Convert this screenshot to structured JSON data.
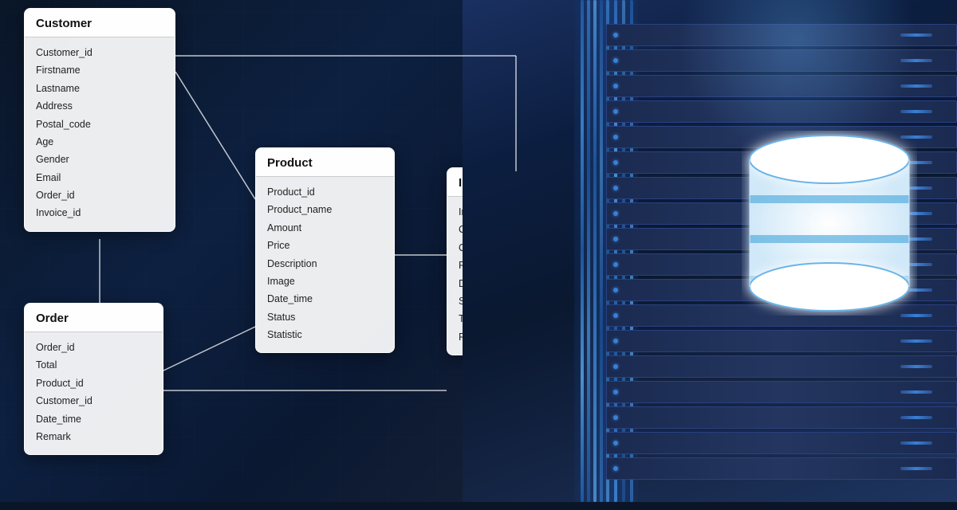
{
  "background": {
    "color_dark": "#0a1628",
    "color_mid": "#0d2040"
  },
  "tables": {
    "customer": {
      "title": "Customer",
      "fields": [
        "Customer_id",
        "Firstname",
        "Lastname",
        "Address",
        "Postal_code",
        "Age",
        "Gender",
        "Email",
        "Order_id",
        "Invoice_id"
      ]
    },
    "product": {
      "title": "Product",
      "fields": [
        "Product_id",
        "Product_name",
        "Amount",
        "Price",
        "Description",
        "Image",
        "Date_time",
        "Status",
        "Statistic"
      ]
    },
    "invoice": {
      "title": "Invoice",
      "fields": [
        "Invoice_id",
        "Customer_id",
        "Order_id",
        "Product_id",
        "Date_time",
        "Status",
        "Total",
        "Remark"
      ]
    },
    "order": {
      "title": "Order",
      "fields": [
        "Order_id",
        "Total",
        "Product_id",
        "Customer_id",
        "Date_time",
        "Remark"
      ]
    }
  },
  "db_icon": {
    "label": "database"
  }
}
